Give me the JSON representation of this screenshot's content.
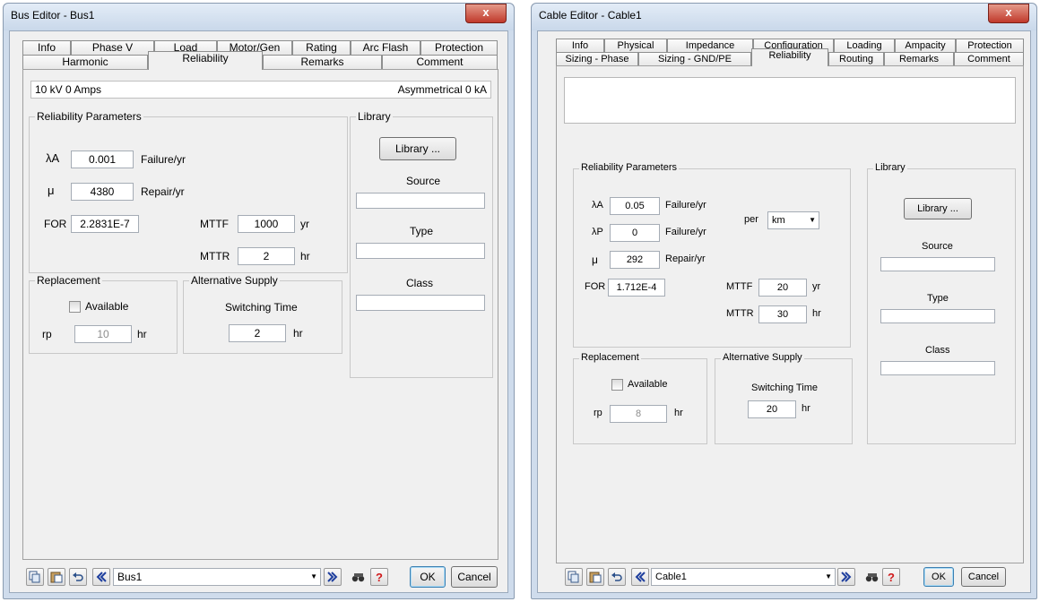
{
  "bus": {
    "title": "Bus Editor - Bus1",
    "close_label": "x",
    "tabs_row1": [
      "Info",
      "Phase V",
      "Load",
      "Motor/Gen",
      "Rating",
      "Arc Flash",
      "Protection"
    ],
    "tabs_row2": [
      "Harmonic",
      "Reliability",
      "Remarks",
      "Comment"
    ],
    "active_tab": "Reliability",
    "info_left": "10 kV 0 Amps",
    "info_right": "Asymmetrical 0 kA",
    "rel_legend": "Reliability Parameters",
    "lambda_a_symbol": "λA",
    "lambda_a_value": "0.001",
    "lambda_a_unit": "Failure/yr",
    "mu_symbol": "μ",
    "mu_value": "4380",
    "mu_unit": "Repair/yr",
    "for_label": "FOR",
    "for_value": "2.2831E-7",
    "mttf_label": "MTTF",
    "mttf_value": "1000",
    "mttf_unit": "yr",
    "mttr_label": "MTTR",
    "mttr_value": "2",
    "mttr_unit": "hr",
    "library_legend": "Library",
    "library_button": "Library ...",
    "source_label": "Source",
    "type_label": "Type",
    "class_label": "Class",
    "replacement_legend": "Replacement",
    "available_label": "Available",
    "rp_label": "rp",
    "rp_value": "10",
    "rp_unit": "hr",
    "alt_legend": "Alternative Supply",
    "switching_label": "Switching Time",
    "switching_value": "2",
    "switching_unit": "hr",
    "id_value": "Bus1",
    "ok": "OK",
    "cancel": "Cancel"
  },
  "cable": {
    "title": "Cable Editor - Cable1",
    "close_label": "x",
    "tabs_row1": [
      "Info",
      "Physical",
      "Impedance",
      "Configuration",
      "Loading",
      "Ampacity",
      "Protection"
    ],
    "tabs_row2": [
      "Sizing - Phase",
      "Sizing - GND/PE",
      "Reliability",
      "Routing",
      "Remarks",
      "Comment"
    ],
    "active_tab": "Reliability",
    "rel_legend": "Reliability Parameters",
    "lambda_a_symbol": "λA",
    "lambda_a_value": "0.05",
    "lambda_a_unit": "Failure/yr",
    "lambda_p_symbol": "λP",
    "lambda_p_value": "0",
    "lambda_p_unit": "Failure/yr",
    "per_label": "per",
    "per_value": "km",
    "mu_symbol": "μ",
    "mu_value": "292",
    "mu_unit": "Repair/yr",
    "for_label": "FOR",
    "for_value": "1.712E-4",
    "mttf_label": "MTTF",
    "mttf_value": "20",
    "mttf_unit": "yr",
    "mttr_label": "MTTR",
    "mttr_value": "30",
    "mttr_unit": "hr",
    "library_legend": "Library",
    "library_button": "Library ...",
    "source_label": "Source",
    "type_label": "Type",
    "class_label": "Class",
    "replacement_legend": "Replacement",
    "available_label": "Available",
    "rp_label": "rp",
    "rp_value": "8",
    "rp_unit": "hr",
    "alt_legend": "Alternative Supply",
    "switching_label": "Switching Time",
    "switching_value": "20",
    "switching_unit": "hr",
    "id_value": "Cable1",
    "ok": "OK",
    "cancel": "Cancel"
  },
  "icons": [
    "copy-icon",
    "paste-icon",
    "undo-icon",
    "previous-icon",
    "next-icon",
    "find-icon",
    "help-icon",
    "close-icon",
    "dropdown-arrow-icon"
  ]
}
